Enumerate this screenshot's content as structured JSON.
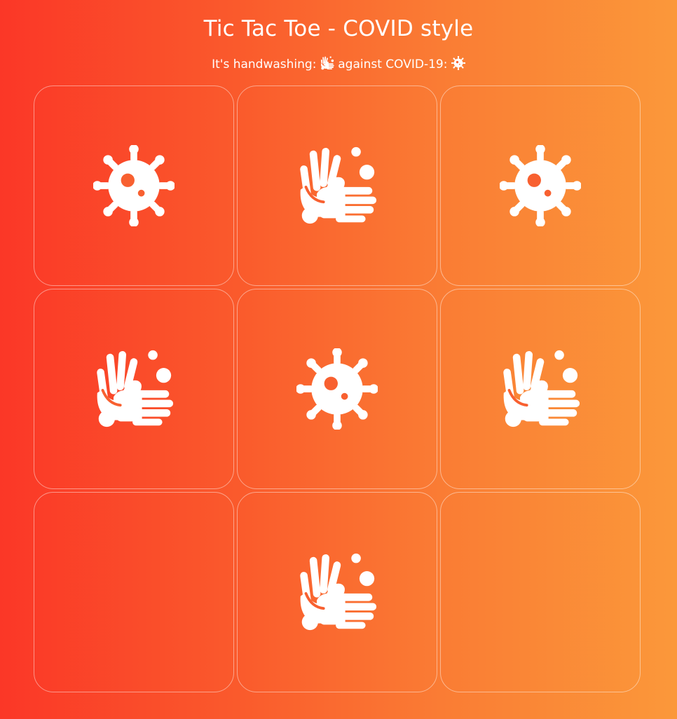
{
  "game": {
    "title": "Tic Tac Toe - COVID style",
    "subtitle_prefix": "It's handwashing:",
    "subtitle_middle": "against COVID-19:",
    "player_x_icon": "handwashing-icon",
    "player_o_icon": "virus-icon"
  },
  "board": {
    "cells": [
      {
        "mark": "virus"
      },
      {
        "mark": "hand"
      },
      {
        "mark": "virus"
      },
      {
        "mark": "hand"
      },
      {
        "mark": "virus"
      },
      {
        "mark": "hand"
      },
      {
        "mark": ""
      },
      {
        "mark": "hand"
      },
      {
        "mark": ""
      }
    ]
  },
  "colors": {
    "gradient_start": "#fb3727",
    "gradient_end": "#fb983a",
    "foreground": "#ffffff"
  }
}
